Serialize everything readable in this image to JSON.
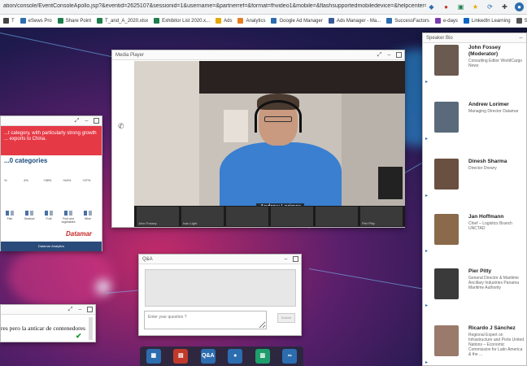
{
  "browser": {
    "url": "ation/console/EventConsoleApollo.jsp?&eventid=2625107&sessionid=1&username=&partnerref=&format=fhvideo1&mobile=&flashsupportedmobiledevice=&helpcenter=&key=0F3ADD9AD94A...",
    "bookmarks": [
      {
        "label": "T",
        "color": "#444"
      },
      {
        "label": "eSews Pro",
        "color": "#2c6db0"
      },
      {
        "label": "Share Point",
        "color": "#1e7e4a"
      },
      {
        "label": "T_and_A_2020.xlsx",
        "color": "#1e7e4a"
      },
      {
        "label": "Exhibitor List 2020.x...",
        "color": "#1e7e4a"
      },
      {
        "label": "Ads",
        "color": "#e6a700"
      },
      {
        "label": "Analytics",
        "color": "#e67e22"
      },
      {
        "label": "Google Ad Manager",
        "color": "#2c6db0"
      },
      {
        "label": "Ads Manager - Ma...",
        "color": "#3b5998"
      },
      {
        "label": "SuccessFactors",
        "color": "#2c6db0"
      },
      {
        "label": "e-days",
        "color": "#7a3ab0"
      },
      {
        "label": "LinkedIn Learning",
        "color": "#0a66c2"
      },
      {
        "label": "Service Now",
        "color": "#555"
      }
    ]
  },
  "media_player": {
    "title": "Media Player",
    "presenter_name": "Andrew Lorimer",
    "thumbnails": [
      "John Fossey",
      "Ivan Light",
      "",
      "",
      "",
      "Piet Pitty"
    ]
  },
  "slide": {
    "headline": "...t category, with particularly strong growth ... exports to China.",
    "subhead": "...0 categories",
    "percentages": [
      "%",
      "4%",
      "+38%",
      "+64%",
      "+37%"
    ],
    "bar_labels": [
      "Fish",
      "Seafood",
      "Fruit",
      "Fruit and vegetables",
      "Wine"
    ],
    "logo": "Datamar",
    "footer": "Datamar Analytics"
  },
  "qa": {
    "title": "Q&A",
    "input_placeholder": "Enter your question ?",
    "submit_label": "Submit"
  },
  "chat": {
    "message": "res pero la anticar de contenedores"
  },
  "speaker_bio": {
    "title": "Speaker Bio",
    "speakers": [
      {
        "name": "John Fossey (Moderator)",
        "role": "Consulting Editor WorldCargo News",
        "color": "#6a5a50"
      },
      {
        "name": "Andrew Lorimer",
        "role": "Managing Director Datamar",
        "color": "#5a6a7a"
      },
      {
        "name": "Dinesh Sharma",
        "role": "Director Drewry",
        "color": "#6a5040"
      },
      {
        "name": "Jan Hoffmann",
        "role": "Chief – Logistics Branch UNCTAD",
        "color": "#8a6a4a"
      },
      {
        "name": "Pier Pitty",
        "role": "General Director & Maritime Ancillary Industries Panama Maritime Authority",
        "color": "#3a3a3a"
      },
      {
        "name": "Ricardo J Sánchez",
        "role": "Regional Expert on Infrastructure and Ports United Nations – Economic Commission for Latin America & the ...",
        "color": "#9a7a6a"
      }
    ]
  },
  "dock": {
    "items": [
      {
        "name": "slides-dock-button",
        "label": "▦",
        "color": "#2c6db0"
      },
      {
        "name": "media-dock-button",
        "label": "▤",
        "color": "#c0392b"
      },
      {
        "name": "qa-dock-button",
        "label": "Q&A",
        "color": "#2c6db0"
      },
      {
        "name": "speaker-dock-button",
        "label": "●",
        "color": "#2c6db0"
      },
      {
        "name": "resources-dock-button",
        "label": "▥",
        "color": "#1e9e6a"
      },
      {
        "name": "links-dock-button",
        "label": "∞",
        "color": "#2c6db0"
      }
    ]
  }
}
